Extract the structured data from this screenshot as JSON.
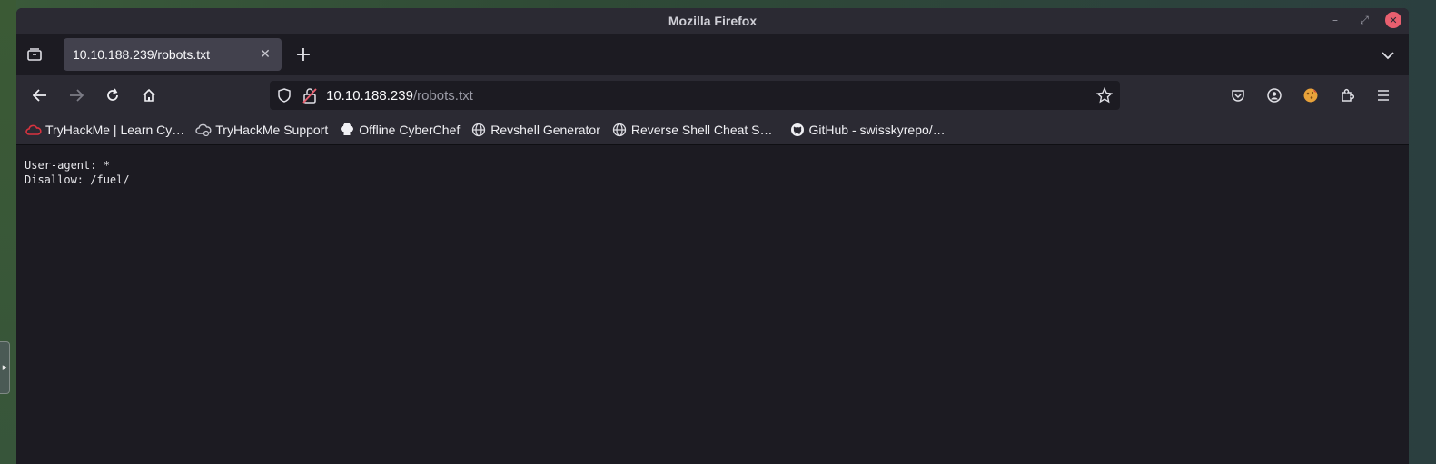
{
  "window": {
    "title": "Mozilla Firefox"
  },
  "tabs": [
    {
      "title": "10.10.188.239/robots.txt",
      "active": true
    }
  ],
  "urlbar": {
    "host": "10.10.188.239",
    "path": "/robots.txt"
  },
  "bookmarks": [
    {
      "label": "TryHackMe | Learn Cy…",
      "icon": "tryhackme-cloud-icon"
    },
    {
      "label": "TryHackMe Support",
      "icon": "support-cloud-icon"
    },
    {
      "label": "Offline CyberChef",
      "icon": "chef-hat-icon"
    },
    {
      "label": "Revshell Generator",
      "icon": "globe-icon"
    },
    {
      "label": "Reverse Shell Cheat S…",
      "icon": "globe-icon"
    },
    {
      "label": "GitHub - swisskyrepo/…",
      "icon": "github-icon"
    }
  ],
  "content": {
    "lines": [
      "User-agent: *",
      "Disallow: /fuel/"
    ]
  },
  "colors": {
    "window_bg": "#1c1b22",
    "toolbar_bg": "#2b2a33",
    "tab_active": "#42414d",
    "close_button": "#e95f6f"
  }
}
